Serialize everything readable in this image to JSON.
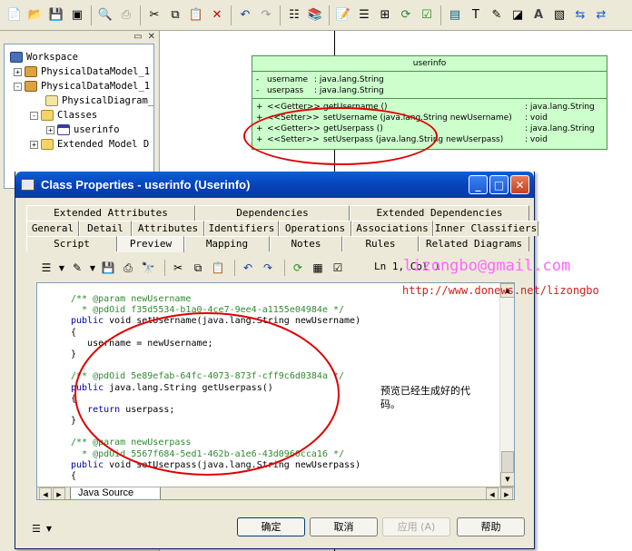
{
  "toolbar": {
    "buttons": [
      "new-icon",
      "open-icon",
      "save-icon",
      "save-all-icon",
      "print-preview-icon",
      "print-icon",
      "cut-icon",
      "copy-icon",
      "paste-icon",
      "delete-icon",
      "undo-icon",
      "redo-icon",
      "properties-icon",
      "library-icon",
      "model-properties-icon",
      "list-icon",
      "tree-icon",
      "refresh-icon",
      "check-icon",
      "table-icon",
      "text-icon",
      "pen-icon",
      "fill-icon",
      "font-icon",
      "image-icon",
      "import-icon",
      "export-icon"
    ]
  },
  "browser": {
    "items": [
      {
        "label": "Workspace",
        "icon": "workspace-icon",
        "expander": ""
      },
      {
        "label": "PhysicalDataModel_1",
        "icon": "model-icon",
        "expander": "+"
      },
      {
        "label": "PhysicalDataModel_1",
        "icon": "model-icon",
        "expander": "-"
      },
      {
        "label": "PhysicalDiagram_",
        "icon": "diagram-icon",
        "expander": ""
      },
      {
        "label": "Classes",
        "icon": "folder-icon",
        "expander": "-"
      },
      {
        "label": "userinfo",
        "icon": "table-icon",
        "expander": "+"
      },
      {
        "label": "Extended Model D",
        "icon": "folder-icon",
        "expander": "+"
      }
    ]
  },
  "uml": {
    "title": "userinfo",
    "attributes": [
      {
        "vis": "-",
        "name": "username",
        "type": ": java.lang.String"
      },
      {
        "vis": "-",
        "name": "userpass",
        "type": ": java.lang.String"
      }
    ],
    "operations": [
      {
        "vis": "+",
        "stereo": "<<Getter>>",
        "sig": "getUsername ()",
        "ret": ": java.lang.String"
      },
      {
        "vis": "+",
        "stereo": "<<Setter>>",
        "sig": "setUsername (java.lang.String newUsername)",
        "ret": ": void"
      },
      {
        "vis": "+",
        "stereo": "<<Getter>>",
        "sig": "getUserpass ()",
        "ret": ": java.lang.String"
      },
      {
        "vis": "+",
        "stereo": "<<Setter>>",
        "sig": "setUserpass (java.lang.String newUserpass)",
        "ret": ": void"
      }
    ]
  },
  "dialog": {
    "title": "Class Properties - userinfo (Userinfo)",
    "tabs_row1": [
      "Extended Attributes",
      "Dependencies",
      "Extended Dependencies"
    ],
    "tabs_row2": [
      "General",
      "Detail",
      "Attributes",
      "Identifiers",
      "Operations",
      "Associations",
      "Inner Classifiers"
    ],
    "tabs_row3": [
      "Script",
      "Preview",
      "Mapping",
      "Notes",
      "Rules",
      "Related Diagrams"
    ],
    "active_tab": "Preview",
    "cursor_pos": "Ln 1, Col 1",
    "code_lines": [
      {
        "type": "comment",
        "text": "/** @param newUsername"
      },
      {
        "type": "comment",
        "text": "  * @pdOid f35d5534-b1a0-4ce7-9ee4-a1155e04984e */"
      },
      {
        "type": "code",
        "text": "public void setUsername(java.lang.String newUsername)"
      },
      {
        "type": "plain",
        "text": "{"
      },
      {
        "type": "plain",
        "text": "   username = newUsername;"
      },
      {
        "type": "plain",
        "text": "}"
      },
      {
        "type": "plain",
        "text": ""
      },
      {
        "type": "comment",
        "text": "/** @pdOid 5e89efab-64fc-4073-873f-cff9c6d0384a */"
      },
      {
        "type": "code",
        "text": "public java.lang.String getUserpass()"
      },
      {
        "type": "plain",
        "text": "{"
      },
      {
        "type": "code",
        "text": "   return userpass;"
      },
      {
        "type": "plain",
        "text": "}"
      },
      {
        "type": "plain",
        "text": ""
      },
      {
        "type": "comment",
        "text": "/** @param newUserpass"
      },
      {
        "type": "comment",
        "text": "  * @pdOid 5567f684-5ed1-462b-a1e6-43d0960cca16 */"
      },
      {
        "type": "code",
        "text": "public void setUserpass(java.lang.String newUserpass)"
      },
      {
        "type": "plain",
        "text": "{"
      }
    ],
    "source_tab": "Java Source",
    "annotation": "预览已经生成好的代码。",
    "buttons": {
      "ok": "确定",
      "cancel": "取消",
      "apply": "应用 (A)",
      "help": "帮助"
    }
  },
  "watermark": {
    "email": "lizongbo@gmail.com",
    "url": "http://www.donews.net/lizongbo"
  }
}
